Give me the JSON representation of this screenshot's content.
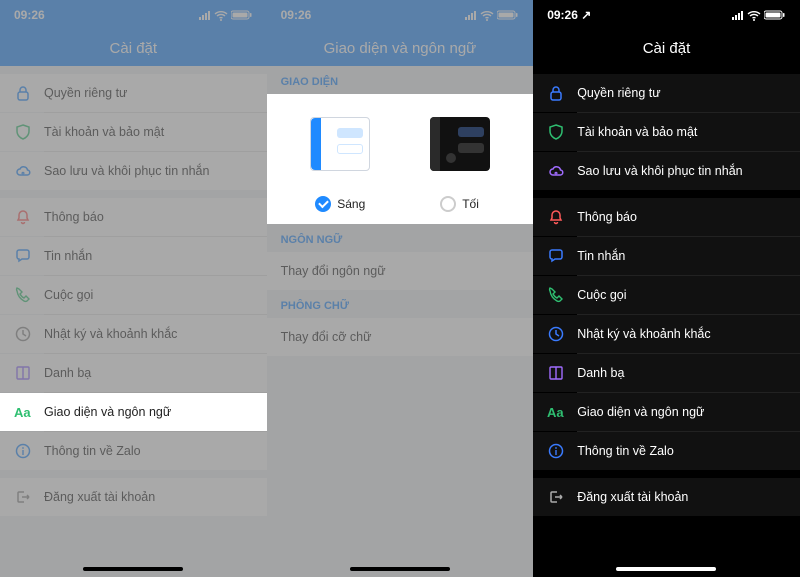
{
  "status": {
    "time": "09:26",
    "loc_arrow": "↗"
  },
  "p1": {
    "title": "Cài đặt",
    "rows": [
      {
        "icon": "lock",
        "label": "Quyền riêng tư",
        "color": "#1f8aff"
      },
      {
        "icon": "shield",
        "label": "Tài khoản và bảo mật",
        "color": "#2fbf71"
      },
      {
        "icon": "cloud",
        "label": "Sao lưu và khôi phục tin nhắn",
        "color": "#1f8aff"
      }
    ],
    "rows2": [
      {
        "icon": "bell",
        "label": "Thông báo",
        "color": "#ff5a5a"
      },
      {
        "icon": "chat",
        "label": "Tin nhắn",
        "color": "#1f8aff"
      },
      {
        "icon": "phone",
        "label": "Cuộc gọi",
        "color": "#2fbf71"
      },
      {
        "icon": "clock",
        "label": "Nhật ký và khoảnh khắc",
        "color": "#888"
      },
      {
        "icon": "book",
        "label": "Danh bạ",
        "color": "#8e6cff"
      },
      {
        "icon": "aa",
        "label": "Giao diện và ngôn ngữ",
        "color": "#2fbf71",
        "hl": true
      },
      {
        "icon": "info",
        "label": "Thông tin về Zalo",
        "color": "#1f8aff"
      }
    ],
    "rows3": [
      {
        "icon": "logout",
        "label": "Đăng xuất tài khoản",
        "color": "#888"
      }
    ]
  },
  "p2": {
    "title": "Giao diện và ngôn ngữ",
    "sec_ui": "GIAO DIỆN",
    "opt_light": "Sáng",
    "opt_dark": "Tối",
    "sec_lang": "NGÔN NGỮ",
    "lang_row": "Thay đổi ngôn ngữ",
    "sec_font": "PHÔNG CHỮ",
    "font_row": "Thay đổi cỡ chữ"
  },
  "p3": {
    "title": "Cài đặt",
    "rows": [
      {
        "icon": "lock",
        "label": "Quyền riêng tư",
        "color": "#3a7bff"
      },
      {
        "icon": "shield",
        "label": "Tài khoản và bảo mật",
        "color": "#2fbf71"
      },
      {
        "icon": "cloud",
        "label": "Sao lưu và khôi phục tin nhắn",
        "color": "#a06cff"
      }
    ],
    "rows2": [
      {
        "icon": "bell",
        "label": "Thông báo",
        "color": "#ff5a5a"
      },
      {
        "icon": "chat",
        "label": "Tin nhắn",
        "color": "#3a7bff"
      },
      {
        "icon": "phone",
        "label": "Cuộc gọi",
        "color": "#2fbf71"
      },
      {
        "icon": "clock",
        "label": "Nhật ký và khoảnh khắc",
        "color": "#3a7bff"
      },
      {
        "icon": "book",
        "label": "Danh bạ",
        "color": "#a06cff"
      },
      {
        "icon": "aa",
        "label": "Giao diện và ngôn ngữ",
        "color": "#2fbf71"
      },
      {
        "icon": "info",
        "label": "Thông tin về Zalo",
        "color": "#3a7bff"
      }
    ],
    "rows3": [
      {
        "icon": "logout",
        "label": "Đăng xuất tài khoản",
        "color": "#aaa"
      }
    ]
  }
}
